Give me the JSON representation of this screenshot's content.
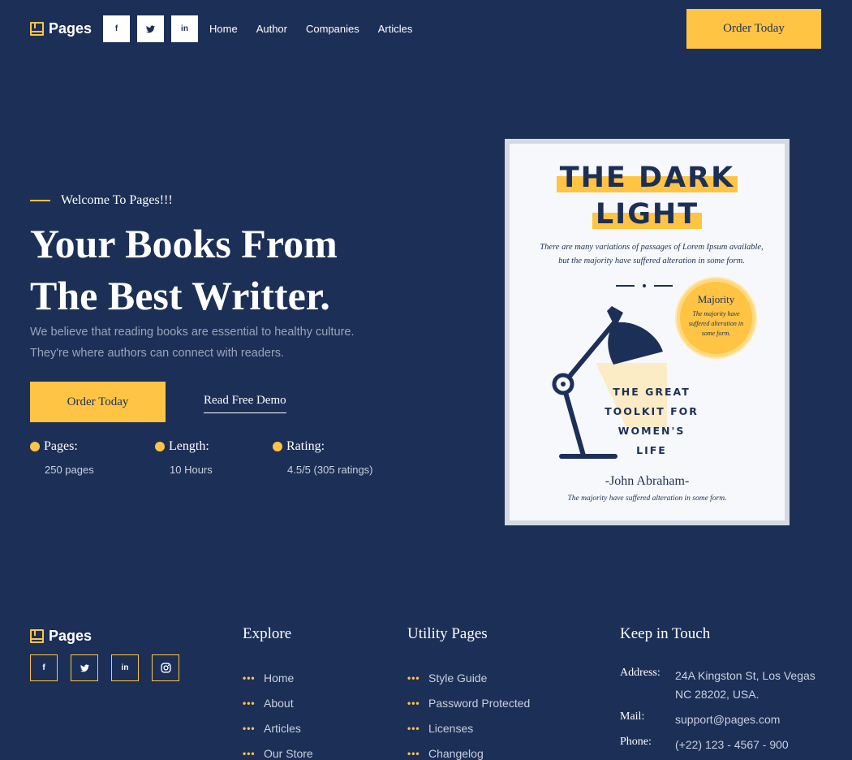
{
  "header": {
    "logo_text": "Pages",
    "social": [
      {
        "icon": "facebook-icon",
        "glyph": "f"
      },
      {
        "icon": "twitter-icon",
        "glyph": "🐦"
      },
      {
        "icon": "linkedin-icon",
        "glyph": "in"
      }
    ],
    "nav": [
      "Home",
      "Author",
      "Companies",
      "Articles"
    ],
    "cta_label": "Order Today"
  },
  "hero": {
    "eyebrow": "Welcome To Pages!!!",
    "title_line1": "Your Books From",
    "title_line2": "The Best Writter.",
    "desc": "We believe that reading books are essential to healthy culture. They're where authors can connect with readers.",
    "order_label": "Order Today",
    "demo_label": "Read Free Demo",
    "stats": [
      {
        "label": "Pages:",
        "value": "250 pages"
      },
      {
        "label": "Length:",
        "value": "10 Hours"
      },
      {
        "label": "Rating:",
        "value": "4.5/5 (305 ratings)"
      }
    ]
  },
  "cover": {
    "title_line1": "THE DARK",
    "title_line2": "LIGHT",
    "subtitle": "There are many variations of passages of Lorem Ipsum available, but the majority have suffered alteration in some form.",
    "badge_title": "Majority",
    "badge_text": "The majority have suffered alteration in some form.",
    "tagline": [
      "THE GREAT",
      "TOOLKIT FOR",
      "WOMEN'S",
      "LIFE"
    ],
    "author": "-John Abraham-",
    "footnote": "The majority have suffered alteration in some form."
  },
  "footer": {
    "logo_text": "Pages",
    "social": [
      {
        "icon": "facebook-icon",
        "glyph": "f"
      },
      {
        "icon": "twitter-icon",
        "glyph": "🐦"
      },
      {
        "icon": "linkedin-icon",
        "glyph": "in"
      },
      {
        "icon": "instagram-icon",
        "glyph": "◎"
      }
    ],
    "explore": {
      "title": "Explore",
      "items": [
        "Home",
        "About",
        "Articles",
        "Our Store"
      ]
    },
    "utility": {
      "title": "Utility Pages",
      "items": [
        "Style Guide",
        "Password Protected",
        "Licenses",
        "Changelog"
      ]
    },
    "contact": {
      "title": "Keep in Touch",
      "address_label": "Address:",
      "address": "24A Kingston St, Los Vegas NC 28202, USA.",
      "mail_label": "Mail:",
      "mail": "support@pages.com",
      "phone_label": "Phone:",
      "phone": "(+22) 123 - 4567 - 900"
    }
  },
  "colors": {
    "background": "#1c2f57",
    "accent": "#ffc444",
    "text_muted": "#9aa4bb"
  }
}
